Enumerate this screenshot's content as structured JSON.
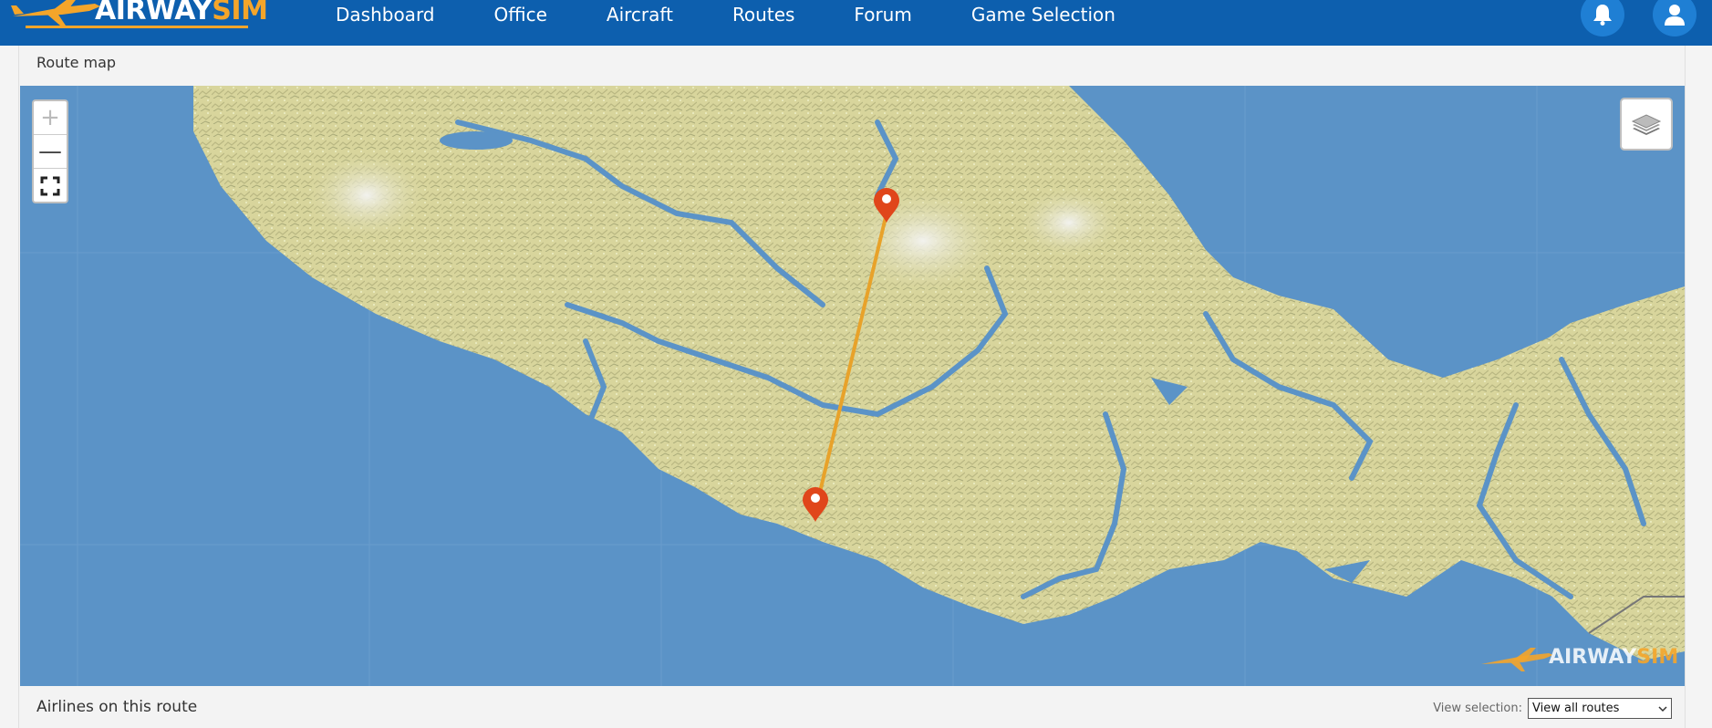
{
  "header": {
    "logo_prefix": "AIRWAY",
    "logo_suffix": "SIM",
    "nav_items": [
      {
        "label": "Dashboard"
      },
      {
        "label": "Office"
      },
      {
        "label": "Aircraft"
      },
      {
        "label": "Routes"
      },
      {
        "label": "Forum"
      },
      {
        "label": "Game Selection"
      }
    ],
    "icons": [
      "bell-icon",
      "user-icon"
    ]
  },
  "route_map": {
    "title": "Route map",
    "zoom_in_label": "+",
    "zoom_out_label": "—",
    "fullscreen_icon": "fullscreen-icon",
    "layers_icon": "layers-icon",
    "watermark_prefix": "AIRWAY",
    "watermark_suffix": "SIM",
    "markers": [
      {
        "name": "origin-marker",
        "color": "#e0461b"
      },
      {
        "name": "destination-marker",
        "color": "#e0461b"
      }
    ],
    "route_color": "#e8a22a"
  },
  "airlines": {
    "title": "Airlines on this route",
    "view_label": "View selection:",
    "view_selected": "View all routes"
  },
  "colors": {
    "nav_bg": "#0d5fae",
    "accent": "#f4a52a",
    "water": "#5b93c7",
    "land": "#d9d8a0"
  }
}
